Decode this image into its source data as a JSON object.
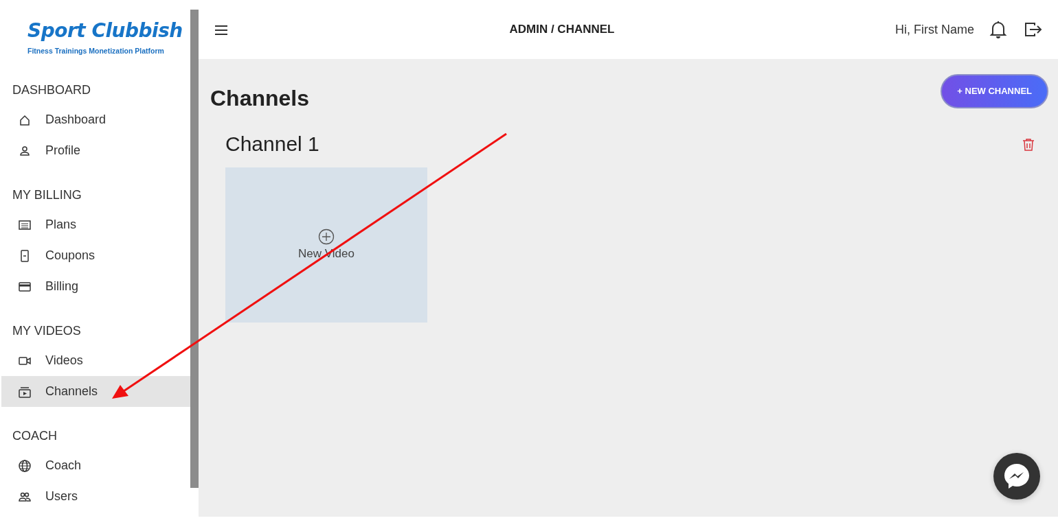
{
  "logo": {
    "title": "Sport Clubbish",
    "tagline": "Fitness Trainings Monetization Platform"
  },
  "sidebar": {
    "sections": [
      {
        "heading": "DASHBOARD",
        "items": [
          {
            "label": "Dashboard",
            "selected": false
          },
          {
            "label": "Profile",
            "selected": false
          }
        ]
      },
      {
        "heading": "MY BILLING",
        "items": [
          {
            "label": "Plans",
            "selected": false
          },
          {
            "label": "Coupons",
            "selected": false
          },
          {
            "label": "Billing",
            "selected": false
          }
        ]
      },
      {
        "heading": "MY VIDEOS",
        "items": [
          {
            "label": "Videos",
            "selected": false
          },
          {
            "label": "Channels",
            "selected": true
          }
        ]
      },
      {
        "heading": "COACH",
        "items": [
          {
            "label": "Coach",
            "selected": false
          },
          {
            "label": "Users",
            "selected": false
          }
        ]
      }
    ]
  },
  "topbar": {
    "breadcrumb": "ADMIN / CHANNEL",
    "greeting": "Hi, First Name"
  },
  "page": {
    "title": "Channels",
    "new_button": "+ NEW CHANNEL"
  },
  "channels": [
    {
      "name": "Channel 1",
      "tiles": [
        {
          "label": "New Video"
        }
      ]
    }
  ]
}
